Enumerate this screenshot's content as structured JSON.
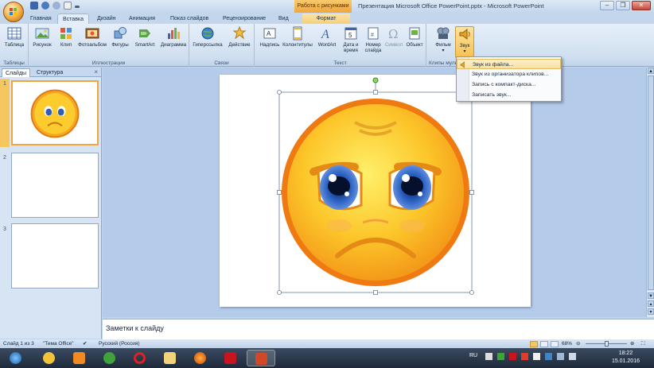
{
  "window": {
    "title": "Презентация Microsoft Office PowerPoint.pptx - Microsoft PowerPoint",
    "context_tab_group": "Работа с рисунками",
    "controls": {
      "minimize": "–",
      "maximize": "❐",
      "close": "✕"
    }
  },
  "tabs": [
    "Главная",
    "Вставка",
    "Дизайн",
    "Анимация",
    "Показ слайдов",
    "Рецензирование",
    "Вид",
    "Формат"
  ],
  "ribbon": {
    "groups": {
      "tables": "Таблицы",
      "illustrations": "Иллюстрации",
      "links": "Связи",
      "text": "Текст",
      "media": "Клипы мультимедиа"
    },
    "buttons": {
      "table": "Таблица",
      "picture": "Рисунок",
      "clip": "Клип",
      "photo_album": "Фотоальбом",
      "shapes": "Фигуры",
      "smartart": "SmartArt",
      "chart": "Диаграмма",
      "hyperlink": "Гиперссылка",
      "action": "Действие",
      "textbox": "Надпись",
      "header_footer": "Колонтитулы",
      "wordart": "WordArt",
      "date_time": "Дата и время",
      "slide_number": "Номер слайда",
      "symbol": "Символ",
      "object": "Объект",
      "movie": "Фильм",
      "sound": "Звук"
    }
  },
  "sound_menu": {
    "items": [
      "Звук из файла...",
      "Звук из организатора клипов...",
      "Запись с компакт-диска...",
      "Записать звук..."
    ]
  },
  "left_pane": {
    "tabs": [
      "Слайды",
      "Структура"
    ],
    "close": "×",
    "slide_numbers": [
      "1",
      "2",
      "3"
    ]
  },
  "notes": {
    "placeholder": "Заметки к слайду"
  },
  "status": {
    "slide_info": "Слайд 1 из 3",
    "theme": "\"Тема Office\"",
    "language": "Русский (Россия)",
    "zoom": "68%"
  },
  "taskbar": {
    "language": "RU",
    "time": "18:22",
    "date": "15.01.2016"
  },
  "colors": {
    "accent": "#f4a43a",
    "ribbon": "#dfe9f5",
    "slide_area": "#b4cbea"
  }
}
